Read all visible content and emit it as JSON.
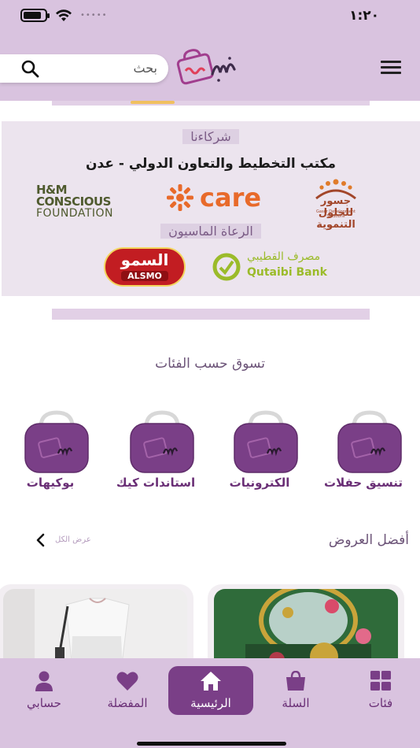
{
  "status_bar": {
    "time": "١:٢٠",
    "signal_dots": "•••••"
  },
  "header": {
    "search_placeholder": "بحث"
  },
  "partners_banner": {
    "partners_title": "شركاءنا",
    "partner_name": "مكتب التخطيط والتعاون الدولي - عدن",
    "hm_line1": "H&M CONSCIOUS",
    "hm_line2": "FOUNDATION",
    "care": "care",
    "jusoor_ar": "جسور للحلول التنموية",
    "jusoor_en": "Gasor Development Solutions",
    "sponsors_title": "الرعاة الماسيون",
    "alsmo_ar": "السمو",
    "alsmo_en": "ALSMO",
    "qutaibi_ar": "مصرف القطيبي",
    "qutaibi_en": "Qutaibi Bank"
  },
  "categories": {
    "title": "تسوق حسب الفئات",
    "items": [
      {
        "label": "تنسيق حفلات"
      },
      {
        "label": "الكترونيات"
      },
      {
        "label": "استاندات كيك"
      },
      {
        "label": "بوكيهات"
      }
    ]
  },
  "offers": {
    "title": "أفضل العروض",
    "view_all": "عرض الكل"
  },
  "tabbar": {
    "items": [
      {
        "label": "فئات",
        "icon": "grid-icon"
      },
      {
        "label": "السلة",
        "icon": "bag-icon"
      },
      {
        "label": "الرئيسية",
        "icon": "home-icon",
        "active": true
      },
      {
        "label": "المفضلة",
        "icon": "heart-icon"
      },
      {
        "label": "حسابي",
        "icon": "user-icon"
      }
    ]
  },
  "colors": {
    "brand_purple": "#7a3f87",
    "header_lilac": "#d9c3df",
    "accent_pink": "#e0405a"
  }
}
